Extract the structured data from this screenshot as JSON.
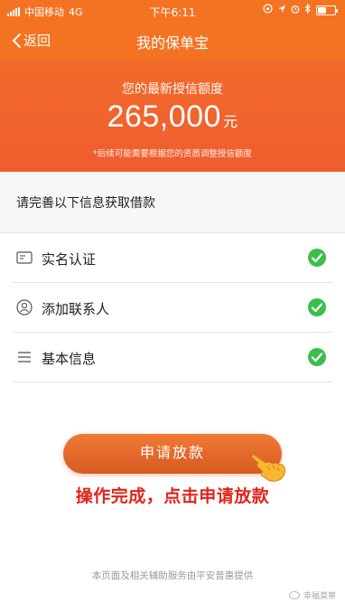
{
  "status_bar": {
    "carrier": "中国移动",
    "network": "4G",
    "time": "下午6:11",
    "icons": [
      "lock-rotation-icon",
      "location-arrow-icon",
      "alarm-icon",
      "bluetooth-icon",
      "battery-icon"
    ],
    "battery_level": 0.45
  },
  "nav": {
    "back_label": "返回",
    "title": "我的保单宝"
  },
  "credit": {
    "label": "您的最新授信额度",
    "amount": "265,000",
    "unit": "元",
    "note": "*后续可能需要根据您的资质调整授信额度"
  },
  "section": {
    "heading": "请完善以下信息获取借款"
  },
  "steps": [
    {
      "label": "实名认证",
      "icon": "id-card-icon",
      "done": true
    },
    {
      "label": "添加联系人",
      "icon": "contact-person-icon",
      "done": true
    },
    {
      "label": "基本信息",
      "icon": "list-icon",
      "done": true
    }
  ],
  "actions": {
    "apply_label": "申请放款"
  },
  "annotation": {
    "caption": "操作完成，点击申请放款"
  },
  "footer": {
    "text": "本页面及相关辅助服务由平安普惠提供"
  },
  "watermark": {
    "text": "幸福莫蒂"
  },
  "colors": {
    "brand_orange": "#f47322",
    "hero_orange": "#ef5d2f",
    "check_green": "#3bbf4a",
    "caption_red": "#e1241b"
  }
}
